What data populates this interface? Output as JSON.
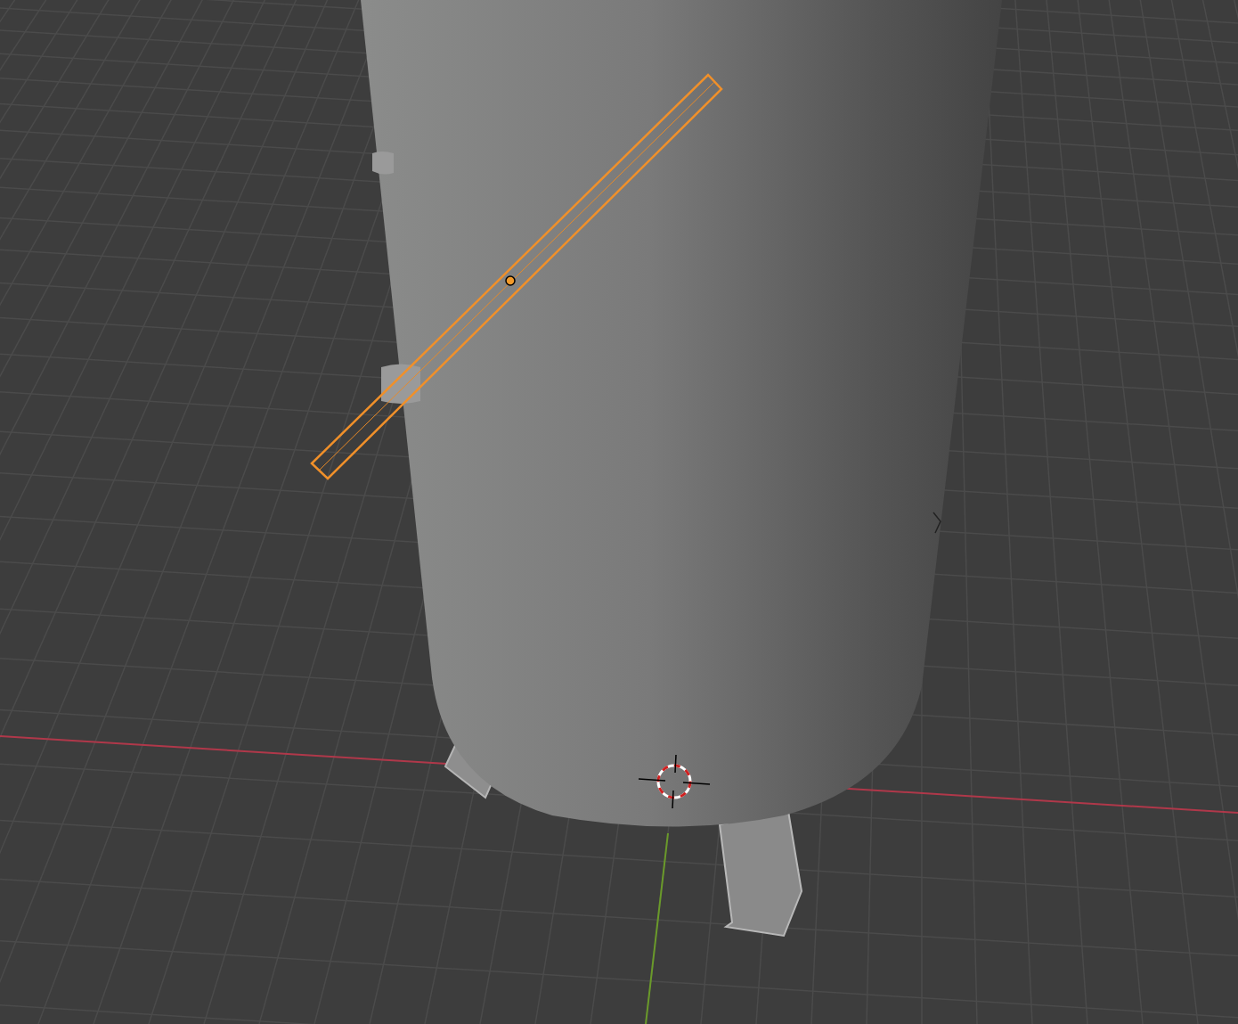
{
  "viewport": {
    "objects": [
      {
        "kind": "tank",
        "selected": false
      },
      {
        "kind": "pipe",
        "selected": true
      }
    ]
  }
}
